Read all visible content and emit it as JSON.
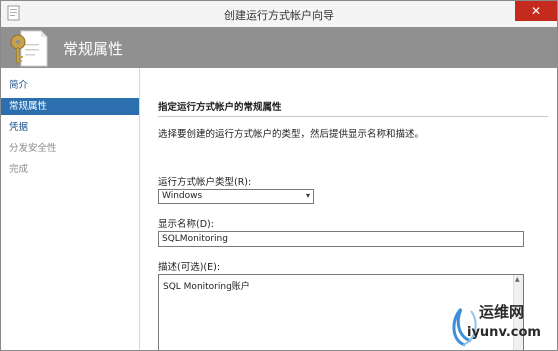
{
  "window": {
    "title": "创建运行方式帐户向导",
    "close_glyph": "✕"
  },
  "header": {
    "title": "常规属性",
    "icon": "property-page-icon"
  },
  "nav": {
    "items": [
      {
        "label": "简介",
        "state": "link"
      },
      {
        "label": "常规属性",
        "state": "active"
      },
      {
        "label": "凭据",
        "state": "link"
      },
      {
        "label": "分发安全性",
        "state": "disabled"
      },
      {
        "label": "完成",
        "state": "disabled"
      }
    ]
  },
  "main": {
    "section_title": "指定运行方式帐户的常规属性",
    "description": "选择要创建的运行方式帐户的类型，然后提供显示名称和描述。",
    "account_type": {
      "label": "运行方式帐户类型(R):",
      "value": "Windows",
      "arrow": "▾"
    },
    "display_name": {
      "label": "显示名称(D):",
      "value": "SQLMonitoring"
    },
    "description_field": {
      "label": "描述(可选)(E):",
      "value": "SQL Monitoring账户",
      "scroll_up_glyph": "▲"
    }
  },
  "watermark": {
    "brand": "运维网",
    "domain": "iyunv.com"
  },
  "colors": {
    "header_bg": "#909090",
    "nav_active": "#2b6faf",
    "close_red": "#c42b1c"
  }
}
